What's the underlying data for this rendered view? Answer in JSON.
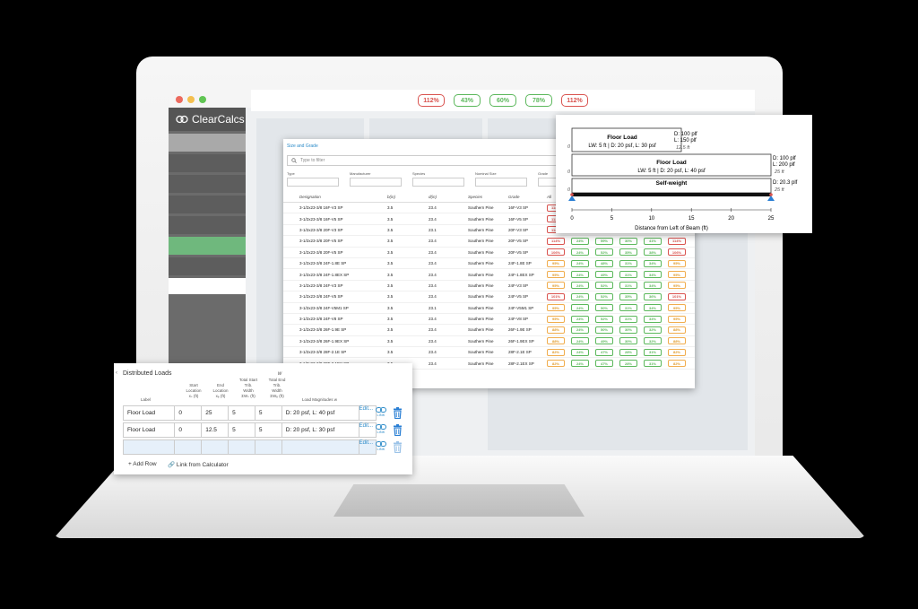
{
  "app": {
    "name": "ClearCalcs",
    "brand_color": "#6fb87d"
  },
  "summary_badges": [
    {
      "text": "112%",
      "status": "fail",
      "color": "#d9534f"
    },
    {
      "text": "43%",
      "status": "pass",
      "color": "#5cb85c"
    },
    {
      "text": "60%",
      "status": "pass",
      "color": "#5cb85c"
    },
    {
      "text": "78%",
      "status": "pass",
      "color": "#5cb85c"
    },
    {
      "text": "112%",
      "status": "fail",
      "color": "#d9534f"
    }
  ],
  "size_grade": {
    "title": "Size and Grade",
    "filter_placeholder": "Type to filter",
    "selects": [
      "Type",
      "Manufacturer",
      "Species",
      "Nominal Size",
      "Grade"
    ],
    "columns": [
      "Designation",
      "b(in)",
      "d(in)",
      "Species",
      "Grade",
      "All"
    ],
    "rows": [
      {
        "designation": "3-1/2x23-3/8 16F-V3 SP",
        "b": "3.5",
        "d": "23.4",
        "species": "Southern Pine",
        "grade": "16F-V3 SP",
        "util": [
          "114%",
          "24%",
          "58%",
          "30%",
          "41%",
          "114%"
        ]
      },
      {
        "designation": "3-1/2x23-3/8 16F-V5 SP",
        "b": "3.5",
        "d": "23.4",
        "species": "Southern Pine",
        "grade": "16F-V5 SP",
        "util": [
          "113%",
          "24%",
          "55%",
          "30%",
          "40%",
          "113%"
        ]
      },
      {
        "designation": "3-1/2x23-3/8 20F-V3 SP",
        "b": "3.5",
        "d": "23.1",
        "species": "Southern Pine",
        "grade": "20F-V3 SP",
        "util": [
          "114%",
          "24%",
          "58%",
          "30%",
          "41%",
          "114%"
        ]
      },
      {
        "designation": "3-1/2x23-3/8 20F-V5 SP",
        "b": "3.5",
        "d": "23.4",
        "species": "Southern Pine",
        "grade": "20F-V5 SP",
        "util": [
          "114%",
          "24%",
          "59%",
          "30%",
          "41%",
          "114%"
        ]
      },
      {
        "designation": "3-1/2x23-3/8 20F-V5 SP",
        "b": "3.5",
        "d": "23.4",
        "species": "Southern Pine",
        "grade": "20F-V5 SP",
        "util": [
          "106%",
          "24%",
          "52%",
          "35%",
          "38%",
          "106%"
        ]
      },
      {
        "designation": "3-1/2x23-3/8 24F-1.8E SP",
        "b": "3.5",
        "d": "23.4",
        "species": "Southern Pine",
        "grade": "24F-1.8E SP",
        "util": [
          "95%",
          "24%",
          "48%",
          "31%",
          "34%",
          "95%"
        ]
      },
      {
        "designation": "3-1/2x23-3/8 24F-1.8EX SP",
        "b": "3.5",
        "d": "23.4",
        "species": "Southern Pine",
        "grade": "24F-1.8EX SP",
        "util": [
          "95%",
          "24%",
          "49%",
          "31%",
          "34%",
          "95%"
        ]
      },
      {
        "designation": "3-1/2x23-3/8 24F-V3 SP",
        "b": "3.5",
        "d": "23.4",
        "species": "Southern Pine",
        "grade": "24F-V3 SP",
        "util": [
          "95%",
          "24%",
          "52%",
          "31%",
          "34%",
          "95%"
        ]
      },
      {
        "designation": "3-1/2x23-3/8 24F-V5 SP",
        "b": "3.5",
        "d": "23.4",
        "species": "Southern Pine",
        "grade": "24F-V5 SP",
        "util": [
          "101%",
          "24%",
          "52%",
          "35%",
          "36%",
          "101%"
        ]
      },
      {
        "designation": "3-1/2x23-3/8 24F-V5M1 SP",
        "b": "3.5",
        "d": "23.1",
        "species": "Southern Pine",
        "grade": "24F-V5M1 SP",
        "util": [
          "95%",
          "24%",
          "50%",
          "31%",
          "34%",
          "95%"
        ]
      },
      {
        "designation": "3-1/2x23-3/8 24F-V8 SP",
        "b": "3.5",
        "d": "23.4",
        "species": "Southern Pine",
        "grade": "24F-V8 SP",
        "util": [
          "95%",
          "24%",
          "52%",
          "31%",
          "34%",
          "95%"
        ]
      },
      {
        "designation": "3-1/2x23-3/8 26F-1.9E SP",
        "b": "3.5",
        "d": "23.4",
        "species": "Southern Pine",
        "grade": "26F-1.9E SP",
        "util": [
          "88%",
          "24%",
          "50%",
          "30%",
          "32%",
          "88%"
        ]
      },
      {
        "designation": "3-1/2x23-3/8 26F-1.9EX SP",
        "b": "3.5",
        "d": "23.4",
        "species": "Southern Pine",
        "grade": "26F-1.9EX SP",
        "util": [
          "88%",
          "24%",
          "49%",
          "30%",
          "32%",
          "88%"
        ]
      },
      {
        "designation": "3-1/2x23-3/8 28F-2.1E SP",
        "b": "3.5",
        "d": "23.4",
        "species": "Southern Pine",
        "grade": "28F-2.1E SP",
        "util": [
          "82%",
          "24%",
          "47%",
          "28%",
          "31%",
          "82%"
        ]
      },
      {
        "designation": "3-1/2x23-3/8 28F-2.1EX SP",
        "b": "3.5",
        "d": "23.4",
        "species": "Southern Pine",
        "grade": "28F-2.1EX SP",
        "util": [
          "82%",
          "24%",
          "47%",
          "28%",
          "31%",
          "82%"
        ]
      }
    ]
  },
  "diagram": {
    "loads": [
      {
        "title": "Floor Load",
        "desc": "LW: 5 ft | D: 20 psf, L: 30 psf",
        "mag": [
          "D: 100 plf",
          "L: 150 plf"
        ],
        "start": "0",
        "end": "12.5 ft"
      },
      {
        "title": "Floor Load",
        "desc": "LW: 5 ft | D: 20 psf, L: 40 psf",
        "mag": [
          "D: 100 plf",
          "L: 200 plf"
        ],
        "start": "0",
        "end": "25 ft"
      },
      {
        "title": "Self-weight",
        "desc": "",
        "mag": [
          "D: 20.3 plf"
        ],
        "start": "0",
        "end": "25 ft"
      }
    ],
    "ticks": [
      "0",
      "5",
      "10",
      "15",
      "20",
      "25"
    ],
    "xlabel": "Distance from Left of Beam (ft)"
  },
  "distributed_loads": {
    "title": "Distributed Loads",
    "headers": {
      "label": "Label",
      "start": [
        "Start",
        "Location",
        "xₛ (ft)"
      ],
      "end": [
        "End",
        "Location",
        "xₑ (ft)"
      ],
      "start_width": [
        "Total Start",
        "Trib.",
        "Width",
        "ΣWₛ (ft)"
      ],
      "end_width": [
        "Total End",
        "Trib.",
        "Width",
        "ΣWₑ (ft)"
      ],
      "mag_title": "w",
      "mag": "Load Magnitudes w"
    },
    "rows": [
      {
        "label": "Floor Load",
        "start": "0",
        "end": "25",
        "ws": "5",
        "we": "5",
        "mag": "D: 20 psf, L: 40 psf",
        "edit": "Edit...",
        "link": "LINK"
      },
      {
        "label": "Floor Load",
        "start": "0",
        "end": "12.5",
        "ws": "5",
        "we": "5",
        "mag": "D: 20 psf, L: 30 psf",
        "edit": "Edit...",
        "link": "LINK"
      },
      {
        "label": "",
        "start": "",
        "end": "",
        "ws": "",
        "we": "",
        "mag": "",
        "edit": "Edit...",
        "link": "LINK"
      }
    ],
    "add_row": "+ Add Row",
    "link_calc": "Link from Calculator"
  }
}
